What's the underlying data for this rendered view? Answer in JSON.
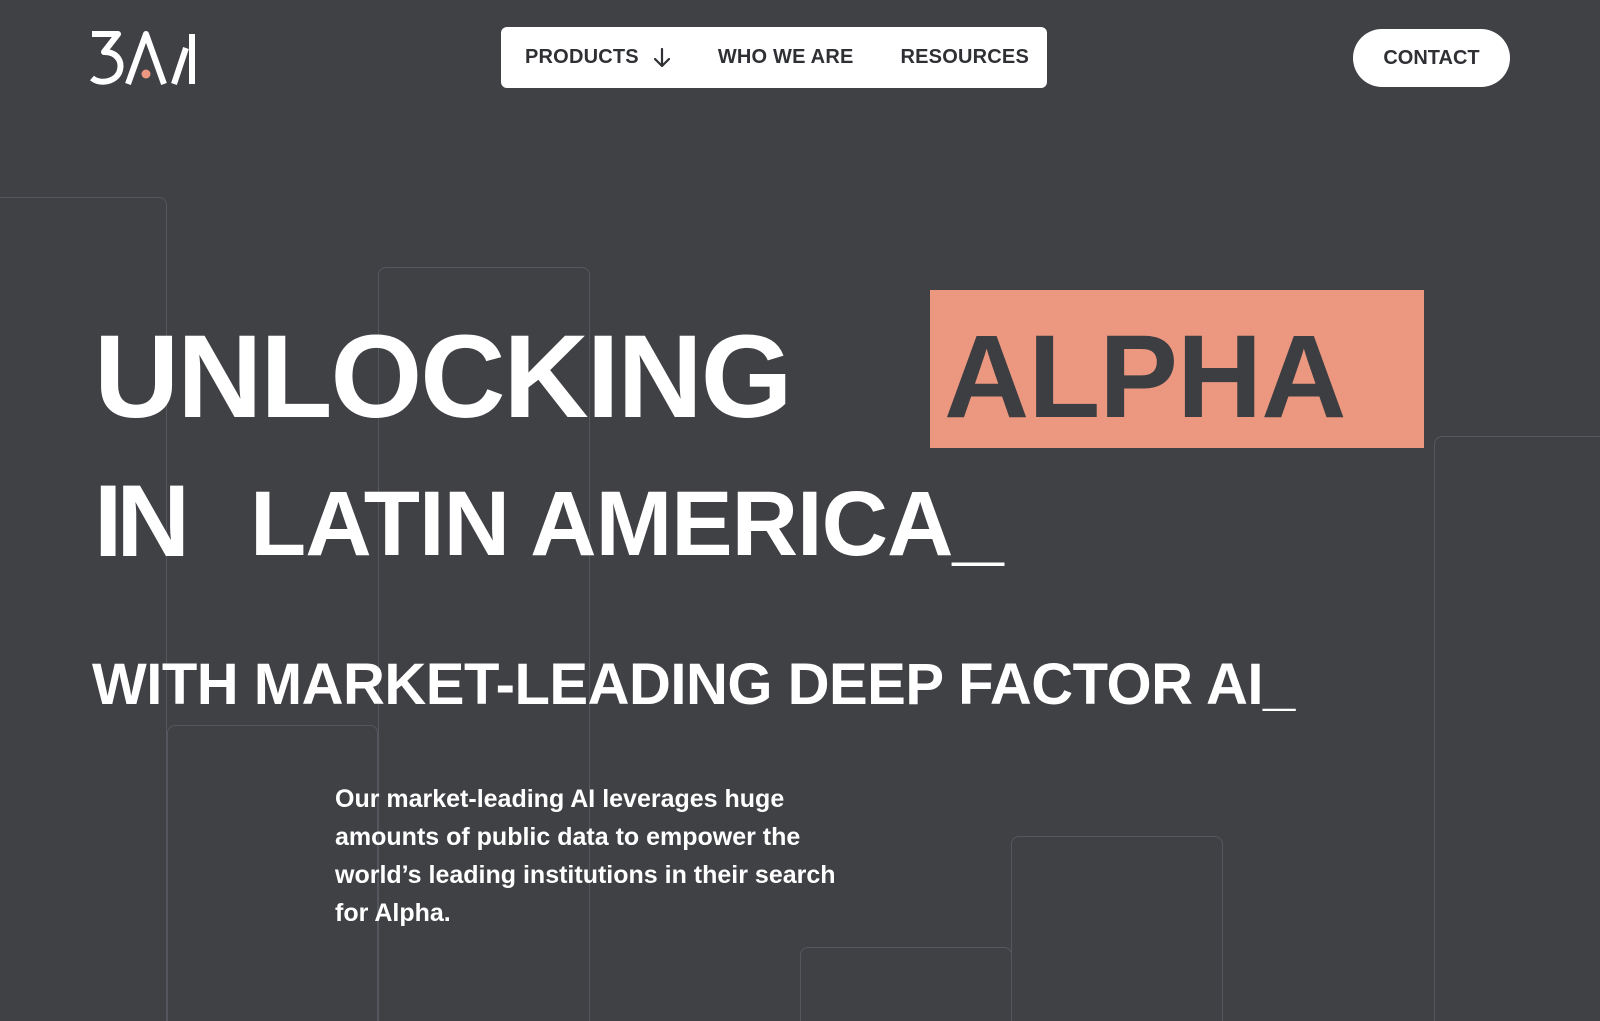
{
  "brand": {
    "logo_text": "3AI",
    "accent_color": "#ec9880",
    "background_color": "#404145"
  },
  "nav": {
    "items": [
      {
        "label": "PRODUCTS",
        "icon": "arrow-down-icon"
      },
      {
        "label": "WHO WE ARE"
      },
      {
        "label": "RESOURCES"
      }
    ],
    "contact_label": "CONTACT"
  },
  "hero": {
    "line1": "UNLOCKING",
    "highlight": "ALPHA",
    "line2_in": "IN",
    "line2_rest": "LATIN AMERICA_",
    "line3": "WITH MARKET-LEADING DEEP FACTOR AI_",
    "description": "Our market-leading AI leverages huge amounts of public data to empower the world’s leading institutions in their search for Alpha."
  }
}
